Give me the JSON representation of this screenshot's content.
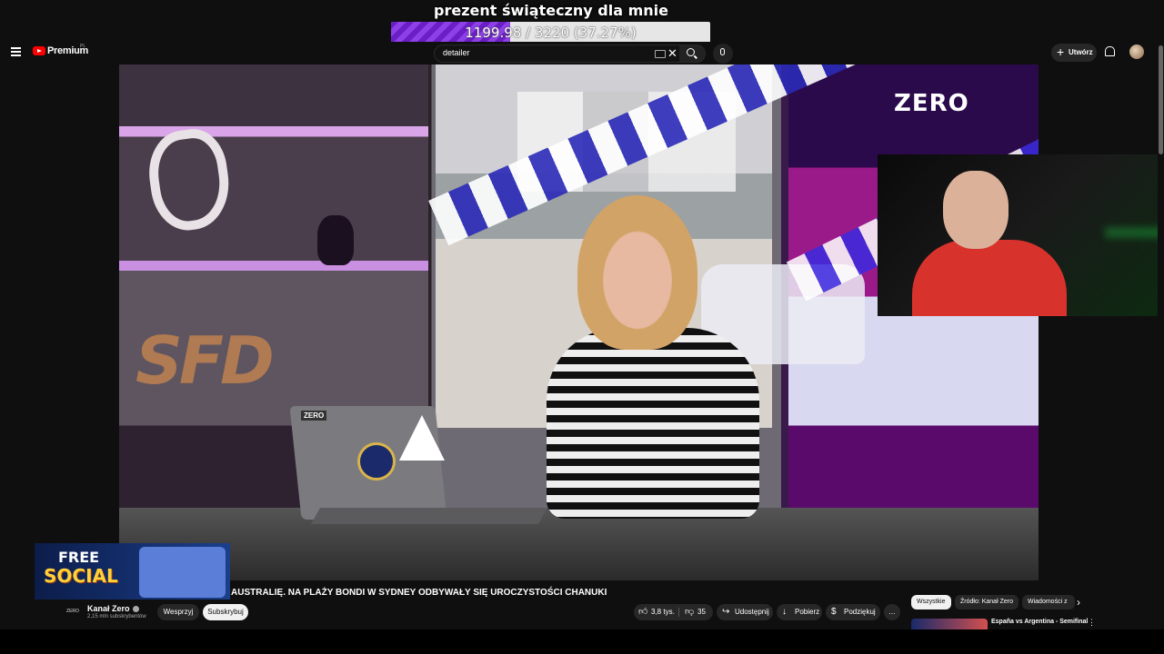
{
  "overlay": {
    "goal_title": "prezent świąteczny dla mnie",
    "goal_text": "1199.98 / 3220 (37.27%)",
    "goal_current": 1199.98,
    "goal_target": 3220,
    "goal_fraction": 0.3727
  },
  "header": {
    "logo_text": "Premium",
    "region": "PL",
    "search_value": "detailer",
    "create_label": "Utwórz"
  },
  "player": {
    "sfd_logo": "SFD",
    "zero_logo": "ZERO",
    "laptop_logo": "ZERO"
  },
  "ad": {
    "line1": "FREE",
    "line2": "SOCIAL"
  },
  "video": {
    "title": "AUSTRALIĘ. NA PLAŻY BONDI W SYDNEY ODBYWAŁY SIĘ UROCZYSTOŚCI CHANUKI",
    "channel_name": "Kanał Zero",
    "channel_logo": "ZERO",
    "subscribers": "2,15 mln subskrybentów",
    "support_label": "Wesprzyj",
    "subscribe_label": "Subskrybuj",
    "likes": "3,8 tys.",
    "dislikes": "35",
    "share_label": "Udostępnij",
    "download_label": "Pobierz",
    "thanks_label": "Podziękuj",
    "more": "…"
  },
  "chips": [
    "Wszystkie",
    "Źródło: Kanał Zero",
    "Wiadomości z"
  ],
  "recommended": {
    "title": "España vs Argentina - Semifinal"
  },
  "colors": {
    "brand_red": "#ff0000",
    "goal_purple": "#8e3fe8",
    "background": "#0f0f0f"
  }
}
